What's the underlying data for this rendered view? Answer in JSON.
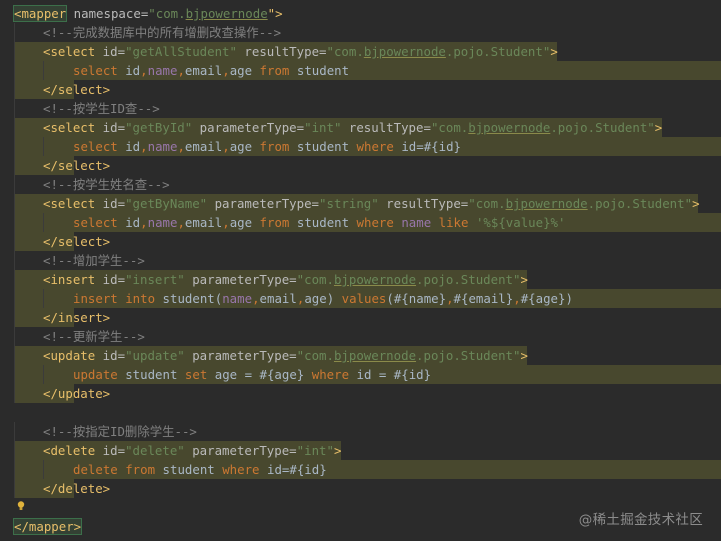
{
  "editor": {
    "lines": [
      {
        "segments": [
          {
            "t": "<mapper",
            "c": "tg",
            "box": true
          },
          {
            "t": " namespace=",
            "c": "at"
          },
          {
            "t": "\"com.",
            "c": "av"
          },
          {
            "t": "bjpowernode",
            "c": "av",
            "u": true
          },
          {
            "t": "\">",
            "c": "tg"
          }
        ]
      },
      {
        "segments": [
          {
            "t": "<!--完成数据库中的所有增删改查操作-->",
            "c": "cm"
          }
        ]
      },
      {
        "segments": [
          {
            "t": "<select",
            "c": "tg"
          },
          {
            "t": " id=",
            "c": "at"
          },
          {
            "t": "\"getAllStudent\"",
            "c": "av"
          },
          {
            "t": " resultType=",
            "c": "at"
          },
          {
            "t": "\"com.",
            "c": "av"
          },
          {
            "t": "bjpowernode",
            "c": "av",
            "u": true
          },
          {
            "t": ".pojo.Student\"",
            "c": "av"
          },
          {
            "t": ">",
            "c": "tg"
          }
        ]
      },
      {
        "segments": [
          {
            "t": "select ",
            "c": "kw"
          },
          {
            "t": "id",
            "c": "tk"
          },
          {
            "t": ",",
            "c": "kw"
          },
          {
            "t": "name",
            "c": "pr"
          },
          {
            "t": ",",
            "c": "kw"
          },
          {
            "t": "email",
            "c": "tk"
          },
          {
            "t": ",",
            "c": "kw"
          },
          {
            "t": "age ",
            "c": "tk"
          },
          {
            "t": "from ",
            "c": "kw"
          },
          {
            "t": "student",
            "c": "tk"
          }
        ]
      },
      {
        "segments": [
          {
            "t": "</select>",
            "c": "tg"
          }
        ]
      },
      {
        "segments": [
          {
            "t": "<!--按学生ID查-->",
            "c": "cm"
          }
        ]
      },
      {
        "segments": [
          {
            "t": "<select",
            "c": "tg"
          },
          {
            "t": " id=",
            "c": "at"
          },
          {
            "t": "\"getById\"",
            "c": "av"
          },
          {
            "t": " parameterType=",
            "c": "at"
          },
          {
            "t": "\"int\"",
            "c": "av"
          },
          {
            "t": " resultType=",
            "c": "at"
          },
          {
            "t": "\"com.",
            "c": "av"
          },
          {
            "t": "bjpowernode",
            "c": "av",
            "u": true
          },
          {
            "t": ".pojo.Student\"",
            "c": "av"
          },
          {
            "t": ">",
            "c": "tg"
          }
        ]
      },
      {
        "segments": [
          {
            "t": "select ",
            "c": "kw"
          },
          {
            "t": "id",
            "c": "tk"
          },
          {
            "t": ",",
            "c": "kw"
          },
          {
            "t": "name",
            "c": "pr"
          },
          {
            "t": ",",
            "c": "kw"
          },
          {
            "t": "email",
            "c": "tk"
          },
          {
            "t": ",",
            "c": "kw"
          },
          {
            "t": "age ",
            "c": "tk"
          },
          {
            "t": "from ",
            "c": "kw"
          },
          {
            "t": "student ",
            "c": "tk"
          },
          {
            "t": "where ",
            "c": "kw"
          },
          {
            "t": "id=#{id}",
            "c": "tk"
          }
        ]
      },
      {
        "segments": [
          {
            "t": "</select>",
            "c": "tg"
          }
        ]
      },
      {
        "segments": [
          {
            "t": "<!--按学生姓名查-->",
            "c": "cm"
          }
        ]
      },
      {
        "segments": [
          {
            "t": "<select",
            "c": "tg"
          },
          {
            "t": " id=",
            "c": "at"
          },
          {
            "t": "\"getByName\"",
            "c": "av"
          },
          {
            "t": " parameterType=",
            "c": "at"
          },
          {
            "t": "\"string\"",
            "c": "av"
          },
          {
            "t": " resultType=",
            "c": "at"
          },
          {
            "t": "\"com.",
            "c": "av"
          },
          {
            "t": "bjpowernode",
            "c": "av",
            "u": true
          },
          {
            "t": ".pojo.Student\"",
            "c": "av"
          },
          {
            "t": ">",
            "c": "tg"
          }
        ]
      },
      {
        "segments": [
          {
            "t": "select ",
            "c": "kw"
          },
          {
            "t": "id",
            "c": "tk"
          },
          {
            "t": ",",
            "c": "kw"
          },
          {
            "t": "name",
            "c": "pr"
          },
          {
            "t": ",",
            "c": "kw"
          },
          {
            "t": "email",
            "c": "tk"
          },
          {
            "t": ",",
            "c": "kw"
          },
          {
            "t": "age ",
            "c": "tk"
          },
          {
            "t": "from ",
            "c": "kw"
          },
          {
            "t": "student ",
            "c": "tk"
          },
          {
            "t": "where ",
            "c": "kw"
          },
          {
            "t": "name ",
            "c": "pr"
          },
          {
            "t": "like ",
            "c": "kw"
          },
          {
            "t": "'%${value}%'",
            "c": "av"
          }
        ]
      },
      {
        "segments": [
          {
            "t": "</select>",
            "c": "tg"
          }
        ]
      },
      {
        "segments": [
          {
            "t": "<!--增加学生-->",
            "c": "cm"
          }
        ]
      },
      {
        "segments": [
          {
            "t": "<insert",
            "c": "tg"
          },
          {
            "t": " id=",
            "c": "at"
          },
          {
            "t": "\"insert\"",
            "c": "av"
          },
          {
            "t": " parameterType=",
            "c": "at"
          },
          {
            "t": "\"com.",
            "c": "av"
          },
          {
            "t": "bjpowernode",
            "c": "av",
            "u": true
          },
          {
            "t": ".pojo.Student\"",
            "c": "av"
          },
          {
            "t": ">",
            "c": "tg"
          }
        ]
      },
      {
        "segments": [
          {
            "t": "insert into ",
            "c": "kw"
          },
          {
            "t": "student(",
            "c": "tk"
          },
          {
            "t": "name",
            "c": "pr"
          },
          {
            "t": ",",
            "c": "kw"
          },
          {
            "t": "email",
            "c": "tk"
          },
          {
            "t": ",",
            "c": "kw"
          },
          {
            "t": "age) ",
            "c": "tk"
          },
          {
            "t": "values",
            "c": "kw"
          },
          {
            "t": "(#{name}",
            "c": "tk"
          },
          {
            "t": ",",
            "c": "kw"
          },
          {
            "t": "#{email}",
            "c": "tk"
          },
          {
            "t": ",",
            "c": "kw"
          },
          {
            "t": "#{age})",
            "c": "tk"
          }
        ]
      },
      {
        "segments": [
          {
            "t": "</insert>",
            "c": "tg"
          }
        ]
      },
      {
        "segments": [
          {
            "t": "<!--更新学生-->",
            "c": "cm"
          }
        ]
      },
      {
        "segments": [
          {
            "t": "<update",
            "c": "tg"
          },
          {
            "t": " id=",
            "c": "at"
          },
          {
            "t": "\"update\"",
            "c": "av"
          },
          {
            "t": " parameterType=",
            "c": "at"
          },
          {
            "t": "\"com.",
            "c": "av"
          },
          {
            "t": "bjpowernode",
            "c": "av",
            "u": true
          },
          {
            "t": ".pojo.Student\"",
            "c": "av"
          },
          {
            "t": ">",
            "c": "tg"
          }
        ]
      },
      {
        "segments": [
          {
            "t": "update ",
            "c": "kw"
          },
          {
            "t": "student ",
            "c": "tk"
          },
          {
            "t": "set ",
            "c": "kw"
          },
          {
            "t": "age = #{age} ",
            "c": "tk"
          },
          {
            "t": "where ",
            "c": "kw"
          },
          {
            "t": "id = #{id}",
            "c": "tk"
          }
        ]
      },
      {
        "segments": [
          {
            "t": "</update>",
            "c": "tg"
          }
        ]
      },
      {
        "segments": []
      },
      {
        "segments": [
          {
            "t": "<!--按指定ID删除学生-->",
            "c": "cm"
          }
        ]
      },
      {
        "segments": [
          {
            "t": "<delete",
            "c": "tg"
          },
          {
            "t": " id=",
            "c": "at"
          },
          {
            "t": "\"delete\"",
            "c": "av"
          },
          {
            "t": " parameterType=",
            "c": "at"
          },
          {
            "t": "\"int\"",
            "c": "av"
          },
          {
            "t": ">",
            "c": "tg"
          }
        ]
      },
      {
        "segments": [
          {
            "t": "delete from ",
            "c": "kw"
          },
          {
            "t": "student ",
            "c": "tk"
          },
          {
            "t": "where ",
            "c": "kw"
          },
          {
            "t": "id=#{id}",
            "c": "tk"
          }
        ]
      },
      {
        "segments": [
          {
            "t": "</delete>",
            "c": "tg"
          }
        ]
      },
      {
        "segments": []
      },
      {
        "segments": [
          {
            "t": "</mapper>",
            "c": "tg",
            "box": true
          }
        ]
      }
    ]
  },
  "watermark": "@稀土掘金技术社区",
  "icons": {
    "intention": "lightbulb-icon"
  },
  "colors": {
    "background": "#2b2b2b",
    "highlight": "#48482e",
    "tag": "#e8bf6a",
    "keyword": "#cc7832",
    "string": "#6a8759",
    "comment": "#808080"
  }
}
